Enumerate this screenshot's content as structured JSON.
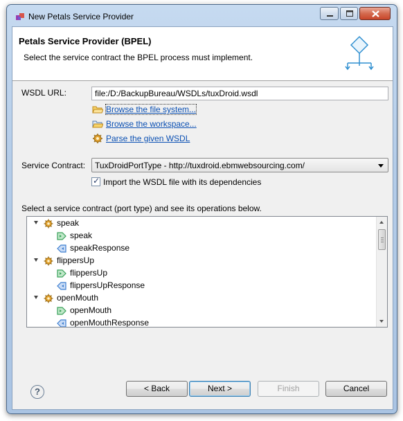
{
  "window": {
    "title": "New Petals Service Provider"
  },
  "banner": {
    "title": "Petals Service Provider (BPEL)",
    "description": "Select the service contract the BPEL process must implement.",
    "icon": "bpel-diagram-icon"
  },
  "wsdl": {
    "label": "WSDL URL:",
    "value": "file:/D:/BackupBureau/WSDLs/tuxDroid.wsdl"
  },
  "links": [
    {
      "label": "Browse the file system...",
      "icon": "folder-open-icon"
    },
    {
      "label": "Browse the workspace...",
      "icon": "workspace-folder-icon"
    },
    {
      "label": "Parse the given WSDL",
      "icon": "gear-icon"
    }
  ],
  "contract": {
    "label": "Service Contract:",
    "selected": "TuxDroidPortType - http://tuxdroid.ebmwebsourcing.com/"
  },
  "import_checkbox": {
    "label": "Import the WSDL file with its dependencies",
    "checked": true
  },
  "tree": {
    "label": "Select a service contract (port type) and see its operations below.",
    "operations": [
      {
        "name": "speak",
        "input": "speak",
        "output": "speakResponse"
      },
      {
        "name": "flippersUp",
        "input": "flippersUp",
        "output": "flippersUpResponse"
      },
      {
        "name": "openMouth",
        "input": "openMouth",
        "output": "openMouthResponse"
      }
    ]
  },
  "buttons": {
    "help": "?",
    "back": "< Back",
    "next": "Next >",
    "finish": "Finish",
    "cancel": "Cancel"
  },
  "colors": {
    "link": "#0b50b3",
    "input_arrow": "#3aa05a",
    "output_arrow": "#3f7fd0"
  }
}
